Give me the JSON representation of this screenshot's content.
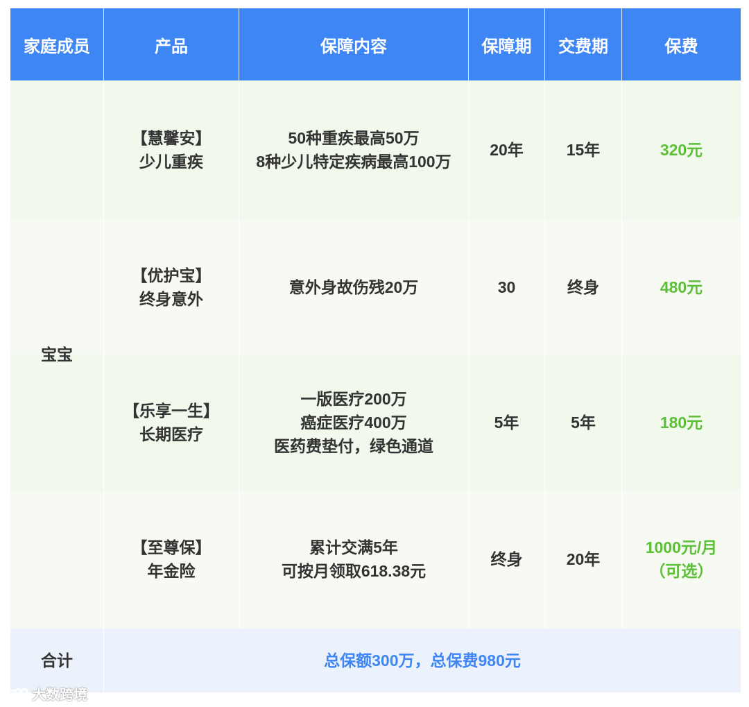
{
  "headers": [
    "家庭成员",
    "产品",
    "保障内容",
    "保障期",
    "交费期",
    "保费"
  ],
  "member": "宝宝",
  "rows": [
    {
      "product": [
        "【慧馨安】",
        "少儿重疾"
      ],
      "coverage": [
        "50种重疾最高50万",
        "8种少儿特定疾病最高100万"
      ],
      "term": "20年",
      "pay_term": "15年",
      "premium": [
        "320元"
      ]
    },
    {
      "product": [
        "【优护宝】",
        "终身意外"
      ],
      "coverage": [
        "意外身故伤残20万"
      ],
      "term": "30",
      "pay_term": "终身",
      "premium": [
        "480元"
      ]
    },
    {
      "product": [
        "【乐享一生】",
        "长期医疗"
      ],
      "coverage": [
        "一版医疗200万",
        "癌症医疗400万",
        "医药费垫付，绿色通道"
      ],
      "term": "5年",
      "pay_term": "5年",
      "premium": [
        "180元"
      ]
    },
    {
      "product": [
        "【至尊保】",
        "年金险"
      ],
      "coverage": [
        "累计交满5年",
        "可按月领取618.38元"
      ],
      "term": "终身",
      "pay_term": "20年",
      "premium": [
        "1000元/月",
        "（可选）"
      ]
    }
  ],
  "total": {
    "label": "合计",
    "text": "总保额300万，总保费980元"
  },
  "watermark": "大数跨境",
  "colors": {
    "header_bg": "#3f86f5",
    "row_bg_a": "#f1f8ec",
    "row_bg_b": "#f6faf2",
    "total_bg": "#ecf2fb",
    "premium_text": "#5cbf38",
    "total_text": "#3f86f5"
  }
}
